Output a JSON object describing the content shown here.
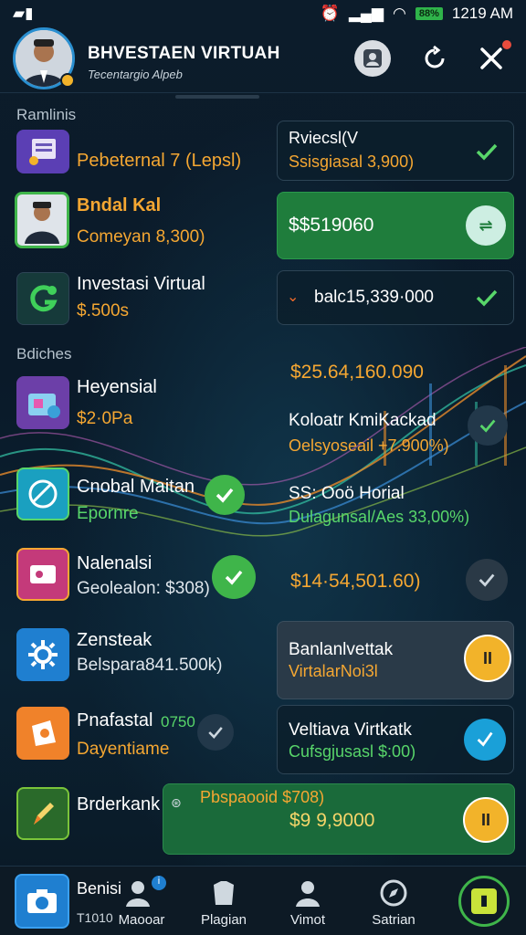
{
  "status_bar": {
    "time": "1219 AM",
    "battery": "88%"
  },
  "header": {
    "title": "BHVESTAEN VIRTUAH",
    "subtitle": "Tecentargio Alpeb"
  },
  "section_top": {
    "label": "Ramlinis"
  },
  "rows_top": [
    {
      "title": "Pebeternal 7 (Lepsl)",
      "title_color": "#f5a732"
    },
    {
      "title": "Bndal Kal",
      "subtitle": "Comeyan 8,300)"
    },
    {
      "title": "Investasi Virtual",
      "subtitle": "$.500s"
    }
  ],
  "cards_top": [
    {
      "title": "Rviecsl(V",
      "subtitle": "Ssisgiasal 3,900)"
    },
    {
      "amount": "$$519060"
    },
    {
      "amount": "balc15,339·000"
    }
  ],
  "section_mid": {
    "label": "Bdiches"
  },
  "rows_mid": [
    {
      "title": "Heyensial",
      "subtitle": "$2·0Pa"
    },
    {
      "title": "Cnobal Maitan",
      "subtitle": "Epornre"
    },
    {
      "title": "Nalenalsi",
      "subtitle": "Geolealon: $308)"
    },
    {
      "title": "Zensteak",
      "subtitle": "Belspara841.500k)"
    },
    {
      "title": "Pnafastal",
      "title_badge": "0750",
      "subtitle": "Dayentiame"
    },
    {
      "title": "Brderkank",
      "subtitle": "Pbspaooid $708)"
    }
  ],
  "right_mid": [
    {
      "amount": "$25.64,160.090"
    },
    {
      "title": "Koloatr KmiKackad",
      "subtitle": "Oelsyoseail +7.900%)"
    },
    {
      "title": "SS: Ooö Horial",
      "subtitle": "Dulagunsal/Aes 33,00%)"
    },
    {
      "amount": "$14·54,501.60)"
    }
  ],
  "cards_bottom": [
    {
      "title": "Banlanlvettak",
      "subtitle": "VirtalarNoi3l",
      "badge": "II"
    },
    {
      "title": "Veltiava Virtkatk",
      "subtitle": "Cufsgjusasl $:00)"
    },
    {
      "amount": "$9 9,9000",
      "badge": "II"
    }
  ],
  "bottom_nav": {
    "items": [
      {
        "label": "Benisi",
        "sublabel": "T1010"
      },
      {
        "label": "Maooar"
      },
      {
        "label": "Plagian"
      },
      {
        "label": "Vimot"
      },
      {
        "label": "Satrian"
      }
    ]
  },
  "colors": {
    "accent_green": "#58d66a",
    "accent_orange": "#f5a732",
    "card_green": "#1e7a3a"
  }
}
